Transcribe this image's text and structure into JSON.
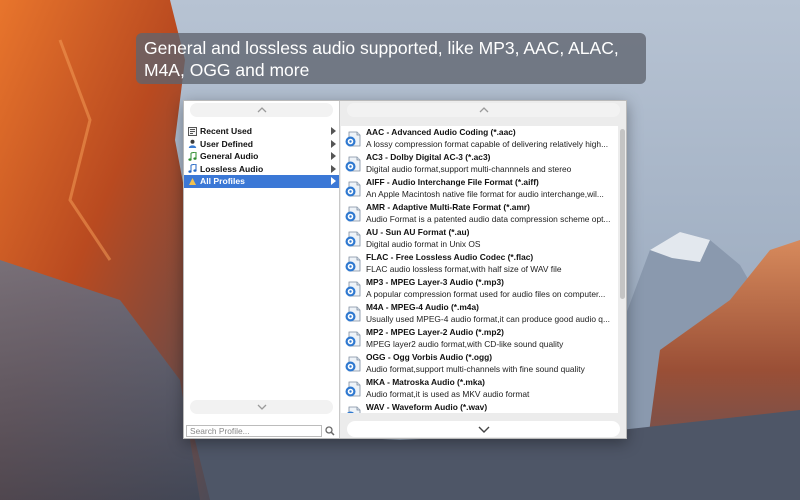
{
  "caption": {
    "text": "General and lossless audio supported, like MP3, AAC, ALAC, M4A, OGG and more"
  },
  "categories": [
    {
      "label": "Recent Used",
      "icon": "recent-icon"
    },
    {
      "label": "User Defined",
      "icon": "user-icon"
    },
    {
      "label": "General Audio",
      "icon": "music-note-icon"
    },
    {
      "label": "Lossless Audio",
      "icon": "music-note-icon"
    },
    {
      "label": "All Profiles",
      "icon": "profiles-icon",
      "selected": true
    }
  ],
  "search": {
    "placeholder": "Search Profile..."
  },
  "formats": [
    {
      "title": "AAC - Advanced Audio Coding (*.aac)",
      "desc": "A lossy compression format capable of delivering relatively high..."
    },
    {
      "title": "AC3 - Dolby Digital AC-3 (*.ac3)",
      "desc": "Digital audio format,support multi-channnels and stereo"
    },
    {
      "title": "AIFF - Audio Interchange File Format (*.aiff)",
      "desc": "An Apple Macintosh native file format for audio interchange,wil..."
    },
    {
      "title": "AMR - Adaptive Multi-Rate Format (*.amr)",
      "desc": "Audio Format is a patented audio data compression scheme opt..."
    },
    {
      "title": "AU - Sun AU Format (*.au)",
      "desc": "Digital audio format in Unix OS"
    },
    {
      "title": "FLAC - Free Lossless Audio Codec (*.flac)",
      "desc": "FLAC audio lossless format,with half size of WAV file"
    },
    {
      "title": "MP3 - MPEG Layer-3 Audio (*.mp3)",
      "desc": "A popular compression format used for audio files on computer..."
    },
    {
      "title": "M4A - MPEG-4 Audio (*.m4a)",
      "desc": "Usually used MPEG-4 audio format,it can produce good audio q..."
    },
    {
      "title": "MP2 - MPEG Layer-2 Audio (*.mp2)",
      "desc": "MPEG layer2 audio format,with CD-like sound quality"
    },
    {
      "title": "OGG - Ogg Vorbis Audio (*.ogg)",
      "desc": "Audio format,support multi-channels with fine sound quality"
    },
    {
      "title": "MKA - Matroska Audio (*.mka)",
      "desc": "Audio format,it is used as MKV audio format"
    },
    {
      "title": "WAV - Waveform Audio (*.wav)",
      "desc": ""
    }
  ],
  "colors": {
    "selection": "#3b78d6",
    "caption_bg": "#5f646e"
  }
}
